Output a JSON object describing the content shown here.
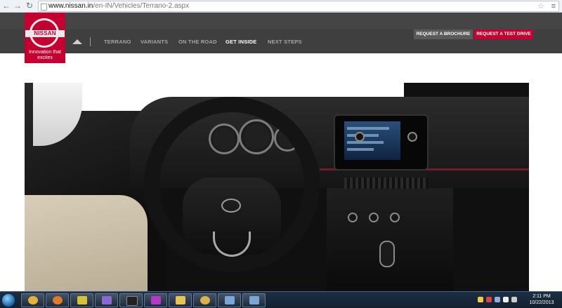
{
  "browser": {
    "url_host": "www.nissan.in",
    "url_path": "/en-IN/Vehicles/Terrano-2.aspx",
    "back_icon": "arrow-left-icon",
    "forward_icon": "arrow-right-icon",
    "reload_icon": "reload-icon",
    "star_icon": "star-icon",
    "menu_icon": "menu-icon"
  },
  "site": {
    "brand": "NISSAN",
    "tagline": "Innovation that excites",
    "brand_color": "#c3002f",
    "buttons": {
      "brochure": "REQUEST A BROCHURE",
      "test_drive": "REQUEST A TEST DRIVE"
    },
    "nav": {
      "home_icon": "home-icon",
      "items": [
        {
          "label": "TERRANO",
          "active": false
        },
        {
          "label": "VARIANTS",
          "active": false
        },
        {
          "label": "ON THE ROAD",
          "active": false
        },
        {
          "label": "GET INSIDE",
          "active": true
        },
        {
          "label": "NEXT STEPS",
          "active": false
        }
      ]
    }
  },
  "hero": {
    "description_icon": "car-interior-image"
  },
  "taskbar": {
    "apps": [
      {
        "icon": "chrome-icon",
        "color": "#e2b23a"
      },
      {
        "icon": "firefox-icon",
        "color": "#e07a2a"
      },
      {
        "icon": "winamp-icon",
        "color": "#d8c13a"
      },
      {
        "icon": "settings-icon",
        "color": "#8a6ad0"
      },
      {
        "icon": "cmd-icon",
        "color": "#222222"
      },
      {
        "icon": "paint-icon",
        "color": "#b33ac7"
      },
      {
        "icon": "folder-icon",
        "color": "#e8c35a"
      },
      {
        "icon": "media-icon",
        "color": "#d9b24d"
      },
      {
        "icon": "window-icon",
        "color": "#7aa6d6"
      },
      {
        "icon": "window-icon-2",
        "color": "#7aa6d6"
      }
    ],
    "time": "2:11 PM",
    "date": "10/22/2013"
  }
}
